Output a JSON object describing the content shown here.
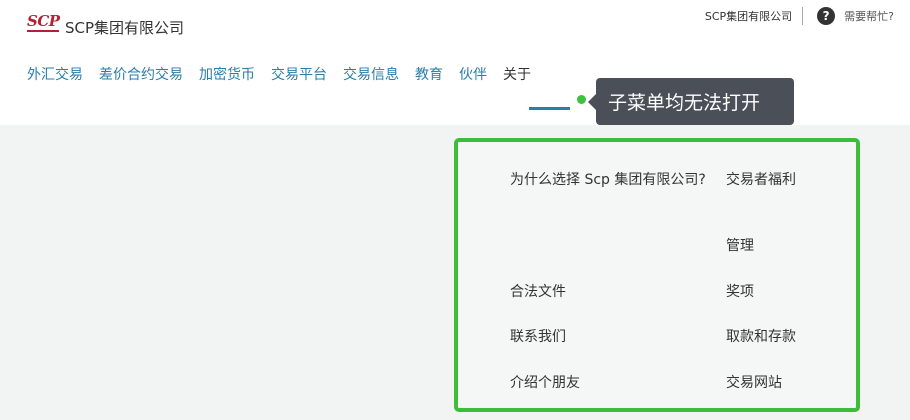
{
  "header": {
    "logo_mark": "SCP",
    "logo_text": "SCP集团有限公司",
    "top_links": {
      "company": "SCP集团有限公司",
      "help": "需要帮忙?"
    },
    "help_icon_glyph": "?"
  },
  "nav": {
    "items": [
      {
        "label": "外汇交易"
      },
      {
        "label": "差价合约交易"
      },
      {
        "label": "加密货币"
      },
      {
        "label": "交易平台"
      },
      {
        "label": "交易信息"
      },
      {
        "label": "教育"
      },
      {
        "label": "伙伴"
      },
      {
        "label": "关于"
      }
    ],
    "active": "关于"
  },
  "annotation": {
    "text": "子菜单均无法打开"
  },
  "submenu": {
    "left": [
      {
        "label": "为什么选择 Scp 集团有限公司?"
      },
      {
        "label": "合法文件"
      },
      {
        "label": "联系我们"
      },
      {
        "label": "介绍个朋友"
      }
    ],
    "right": [
      {
        "label": "交易者福利"
      },
      {
        "label": "管理"
      },
      {
        "label": "奖项"
      },
      {
        "label": "取款和存款"
      },
      {
        "label": "交易网站"
      }
    ]
  },
  "colors": {
    "nav_link": "#2a7ea8",
    "logo_red": "#b22234",
    "highlight_green": "#3cbe3a",
    "tooltip_bg": "#4a4f58",
    "content_bg": "#f2f4f3"
  }
}
